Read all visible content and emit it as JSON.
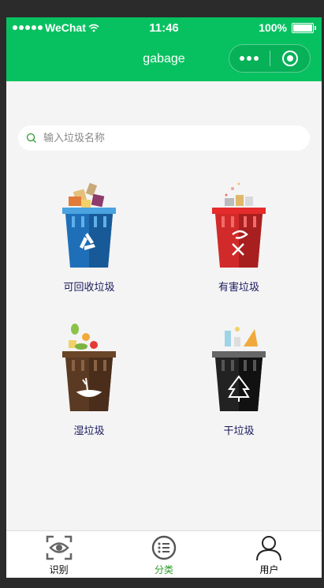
{
  "status_bar": {
    "carrier": "WeChat",
    "time": "11:46",
    "battery": "100%"
  },
  "navbar": {
    "title": "gabage"
  },
  "search": {
    "placeholder": "输入垃圾名称",
    "value": ""
  },
  "categories": [
    {
      "label": "可回收垃圾",
      "color": "#1f6fb8",
      "icon": "recycle-icon"
    },
    {
      "label": "有害垃圾",
      "color": "#d12a2a",
      "icon": "hazard-icon"
    },
    {
      "label": "湿垃圾",
      "color": "#5b3a23",
      "icon": "food-waste-icon"
    },
    {
      "label": "干垃圾",
      "color": "#222222",
      "icon": "dry-waste-icon"
    }
  ],
  "tabbar": {
    "items": [
      {
        "label": "识别",
        "icon": "eye-scan-icon",
        "active": false
      },
      {
        "label": "分类",
        "icon": "list-icon",
        "active": true
      },
      {
        "label": "用户",
        "icon": "user-icon",
        "active": false
      }
    ]
  },
  "colors": {
    "brand": "#07c160",
    "active_tab": "#2a9d2a"
  }
}
